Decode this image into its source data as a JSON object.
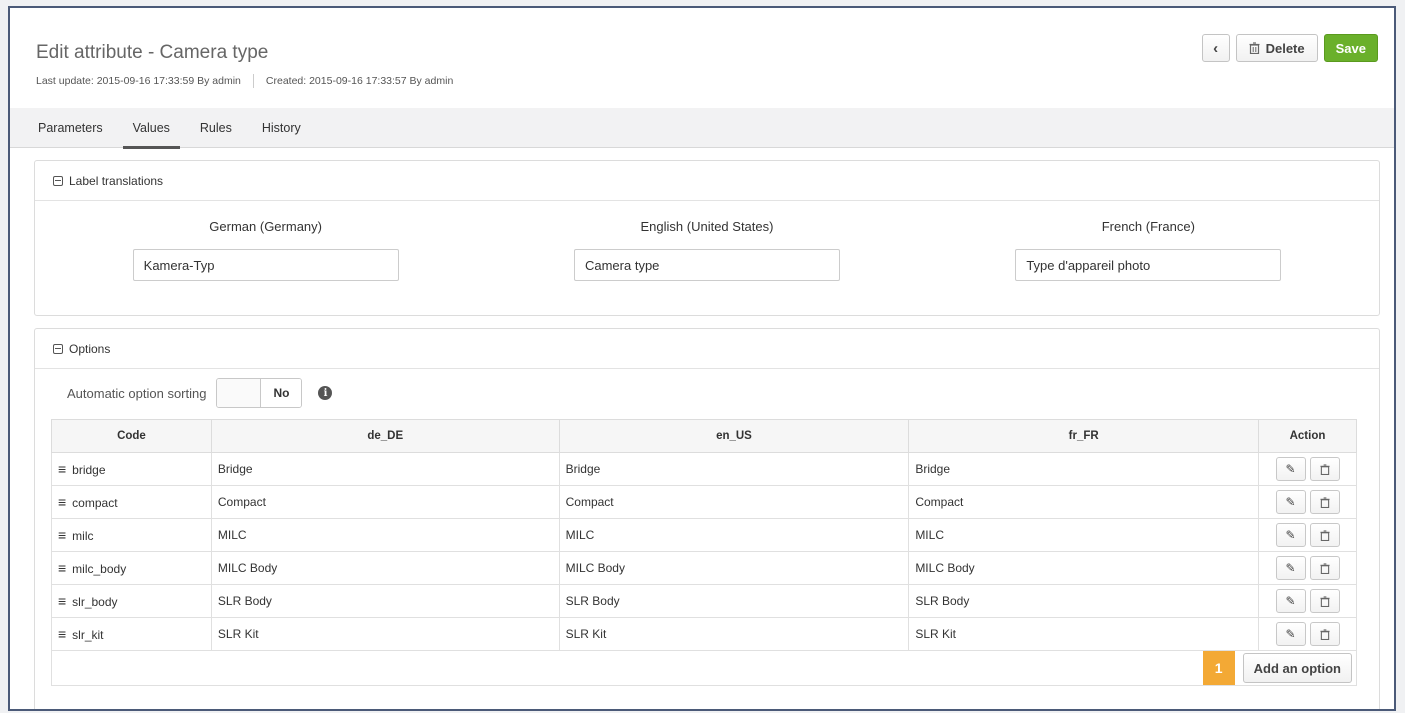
{
  "header": {
    "title": "Edit attribute - Camera type",
    "last_update": "Last update: 2015-09-16 17:33:59 By admin",
    "created": "Created: 2015-09-16 17:33:57 By admin",
    "back_icon": "‹",
    "delete_label": "Delete",
    "save_label": "Save"
  },
  "tabs": [
    {
      "label": "Parameters"
    },
    {
      "label": "Values",
      "active": true
    },
    {
      "label": "Rules"
    },
    {
      "label": "History"
    }
  ],
  "translations": {
    "title": "Label translations",
    "langs": [
      {
        "name": "German (Germany)",
        "value": "Kamera-Typ"
      },
      {
        "name": "English (United States)",
        "value": "Camera type"
      },
      {
        "name": "French (France)",
        "value": "Type d'appareil photo"
      }
    ]
  },
  "options": {
    "title": "Options",
    "sorting_label": "Automatic option sorting",
    "sorting_value": "No",
    "columns": [
      "Code",
      "de_DE",
      "en_US",
      "fr_FR",
      "Action"
    ],
    "rows": [
      {
        "code": "bridge",
        "de": "Bridge",
        "en": "Bridge",
        "fr": "Bridge"
      },
      {
        "code": "compact",
        "de": "Compact",
        "en": "Compact",
        "fr": "Compact"
      },
      {
        "code": "milc",
        "de": "MILC",
        "en": "MILC",
        "fr": "MILC"
      },
      {
        "code": "milc_body",
        "de": "MILC Body",
        "en": "MILC Body",
        "fr": "MILC Body"
      },
      {
        "code": "slr_body",
        "de": "SLR Body",
        "en": "SLR Body",
        "fr": "SLR Body"
      },
      {
        "code": "slr_kit",
        "de": "SLR Kit",
        "en": "SLR Kit",
        "fr": "SLR Kit"
      }
    ],
    "badge": "1",
    "add_label": "Add an option"
  },
  "colors": {
    "save": "#6ab02b",
    "badge": "#f3a935",
    "frame": "#4b5a78"
  }
}
